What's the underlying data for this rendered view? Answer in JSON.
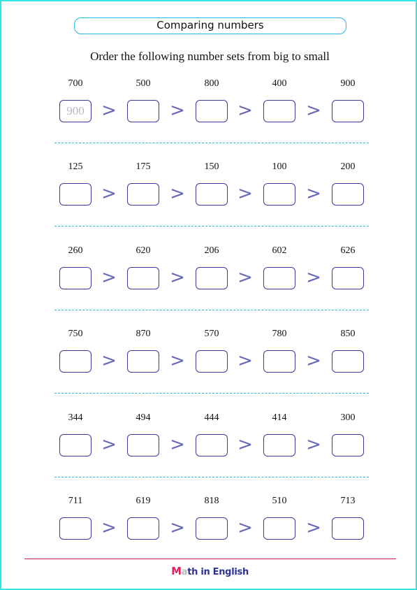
{
  "header": {
    "title": "Comparing numbers",
    "instruction": "Order the following number sets from big to small"
  },
  "comparison_symbol": ">",
  "rows": [
    {
      "numbers": [
        "700",
        "500",
        "800",
        "400",
        "900"
      ],
      "answers": [
        "900",
        "",
        "",
        "",
        ""
      ]
    },
    {
      "numbers": [
        "125",
        "175",
        "150",
        "100",
        "200"
      ],
      "answers": [
        "",
        "",
        "",
        "",
        ""
      ]
    },
    {
      "numbers": [
        "260",
        "620",
        "206",
        "602",
        "626"
      ],
      "answers": [
        "",
        "",
        "",
        "",
        ""
      ]
    },
    {
      "numbers": [
        "750",
        "870",
        "570",
        "780",
        "850"
      ],
      "answers": [
        "",
        "",
        "",
        "",
        ""
      ]
    },
    {
      "numbers": [
        "344",
        "494",
        "444",
        "414",
        "300"
      ],
      "answers": [
        "",
        "",
        "",
        "",
        ""
      ]
    },
    {
      "numbers": [
        "711",
        "619",
        "818",
        "510",
        "713"
      ],
      "answers": [
        "",
        "",
        "",
        "",
        ""
      ]
    }
  ],
  "footer": {
    "brand_first_letter": "M",
    "brand_second_letter": "a",
    "brand_rest": "th in English"
  },
  "colors": {
    "page_border": "#33e6e6",
    "title_border": "#29b6e0",
    "box_border": "#3b3b9a",
    "symbol": "#6868b8",
    "separator": "#29b6e0",
    "footer_line": "#c2185b",
    "brand_blue": "#2e3192",
    "brand_red": "#e0245e",
    "example_answer": "#b8b8c4"
  }
}
